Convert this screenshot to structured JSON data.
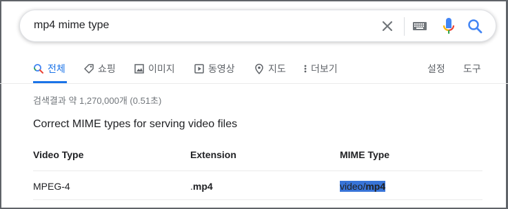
{
  "search": {
    "query": "mp4 mime type"
  },
  "icons": {
    "clear": "close-icon",
    "keyboard": "keyboard-icon",
    "mic": "microphone-icon",
    "search": "search-icon"
  },
  "tabs": [
    {
      "label": "전체",
      "icon": "search-icon",
      "active": true
    },
    {
      "label": "쇼핑",
      "icon": "tag-icon"
    },
    {
      "label": "이미지",
      "icon": "image-icon"
    },
    {
      "label": "동영상",
      "icon": "play-icon"
    },
    {
      "label": "지도",
      "icon": "map-pin-icon"
    },
    {
      "label": "더보기",
      "icon": "more-vert-icon"
    }
  ],
  "tools": {
    "settings": "설정",
    "tools": "도구"
  },
  "results": {
    "stats": "검색결과 약 1,270,000개 (0.51초)",
    "snippet_title": "Correct MIME types for serving video files",
    "table": {
      "headers": [
        "Video Type",
        "Extension",
        "MIME Type"
      ],
      "rows": [
        {
          "type": "MPEG-4",
          "ext_dot": ".",
          "ext_bold": "mp4",
          "mime_plain": "video/",
          "mime_bold": "mp4"
        }
      ]
    }
  },
  "colors": {
    "accent": "#1a73e8",
    "selection": "#3874d8",
    "muted": "#70757a"
  }
}
